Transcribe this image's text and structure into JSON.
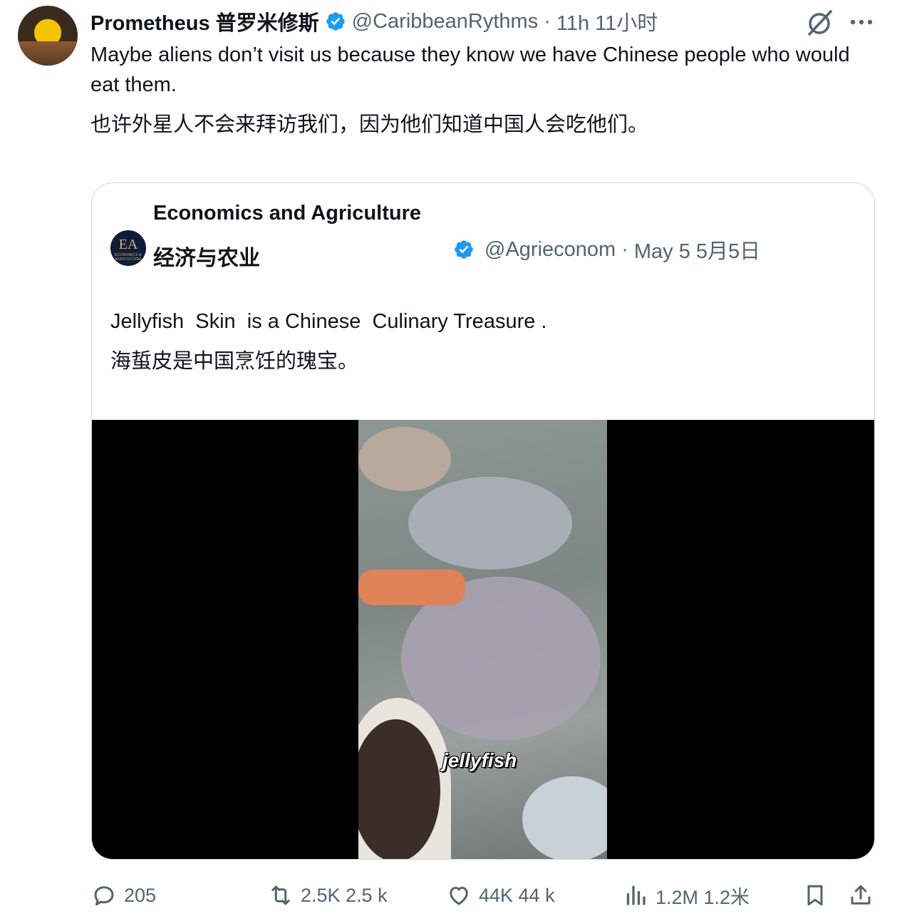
{
  "tweet": {
    "display_name": "Prometheus 普罗米修斯",
    "handle": "@CaribbeanRythms",
    "separator": "·",
    "time": "11h 11小时",
    "text_en": "Maybe aliens don’t visit us because they know we have Chinese people who would eat them.",
    "text_zh": "也许外星人不会来拜访我们，因为他们知道中国人会吃他们。"
  },
  "quote": {
    "name_en": "Economics and Agriculture",
    "avatar_text": "EA",
    "avatar_subtext": "ECONOMICS & AGRICULTURE",
    "name_zh": "经济与农业",
    "handle": "@Agrieconom",
    "separator": "·",
    "date": "May 5 5月5日",
    "text_en": "Jellyfish  Skin  is a Chinese  Culinary Treasure .",
    "text_zh": "海蜇皮是中国烹饪的瑰宝。",
    "video_caption": "jellyfish"
  },
  "actions": {
    "replies": "205",
    "reposts": "2.5K 2.5 k",
    "likes": "44K 44 k",
    "views": "1.2M 1.2米"
  },
  "icons": {
    "verified": "verified-badge-icon",
    "grok": "grok-icon",
    "more": "more-icon",
    "reply": "reply-icon",
    "repost": "repost-icon",
    "like": "like-icon",
    "views": "views-icon",
    "bookmark": "bookmark-icon",
    "share": "share-icon"
  },
  "colors": {
    "verified_blue": "#1d9bf0",
    "secondary_text": "#536471",
    "border": "#cfd9de"
  }
}
